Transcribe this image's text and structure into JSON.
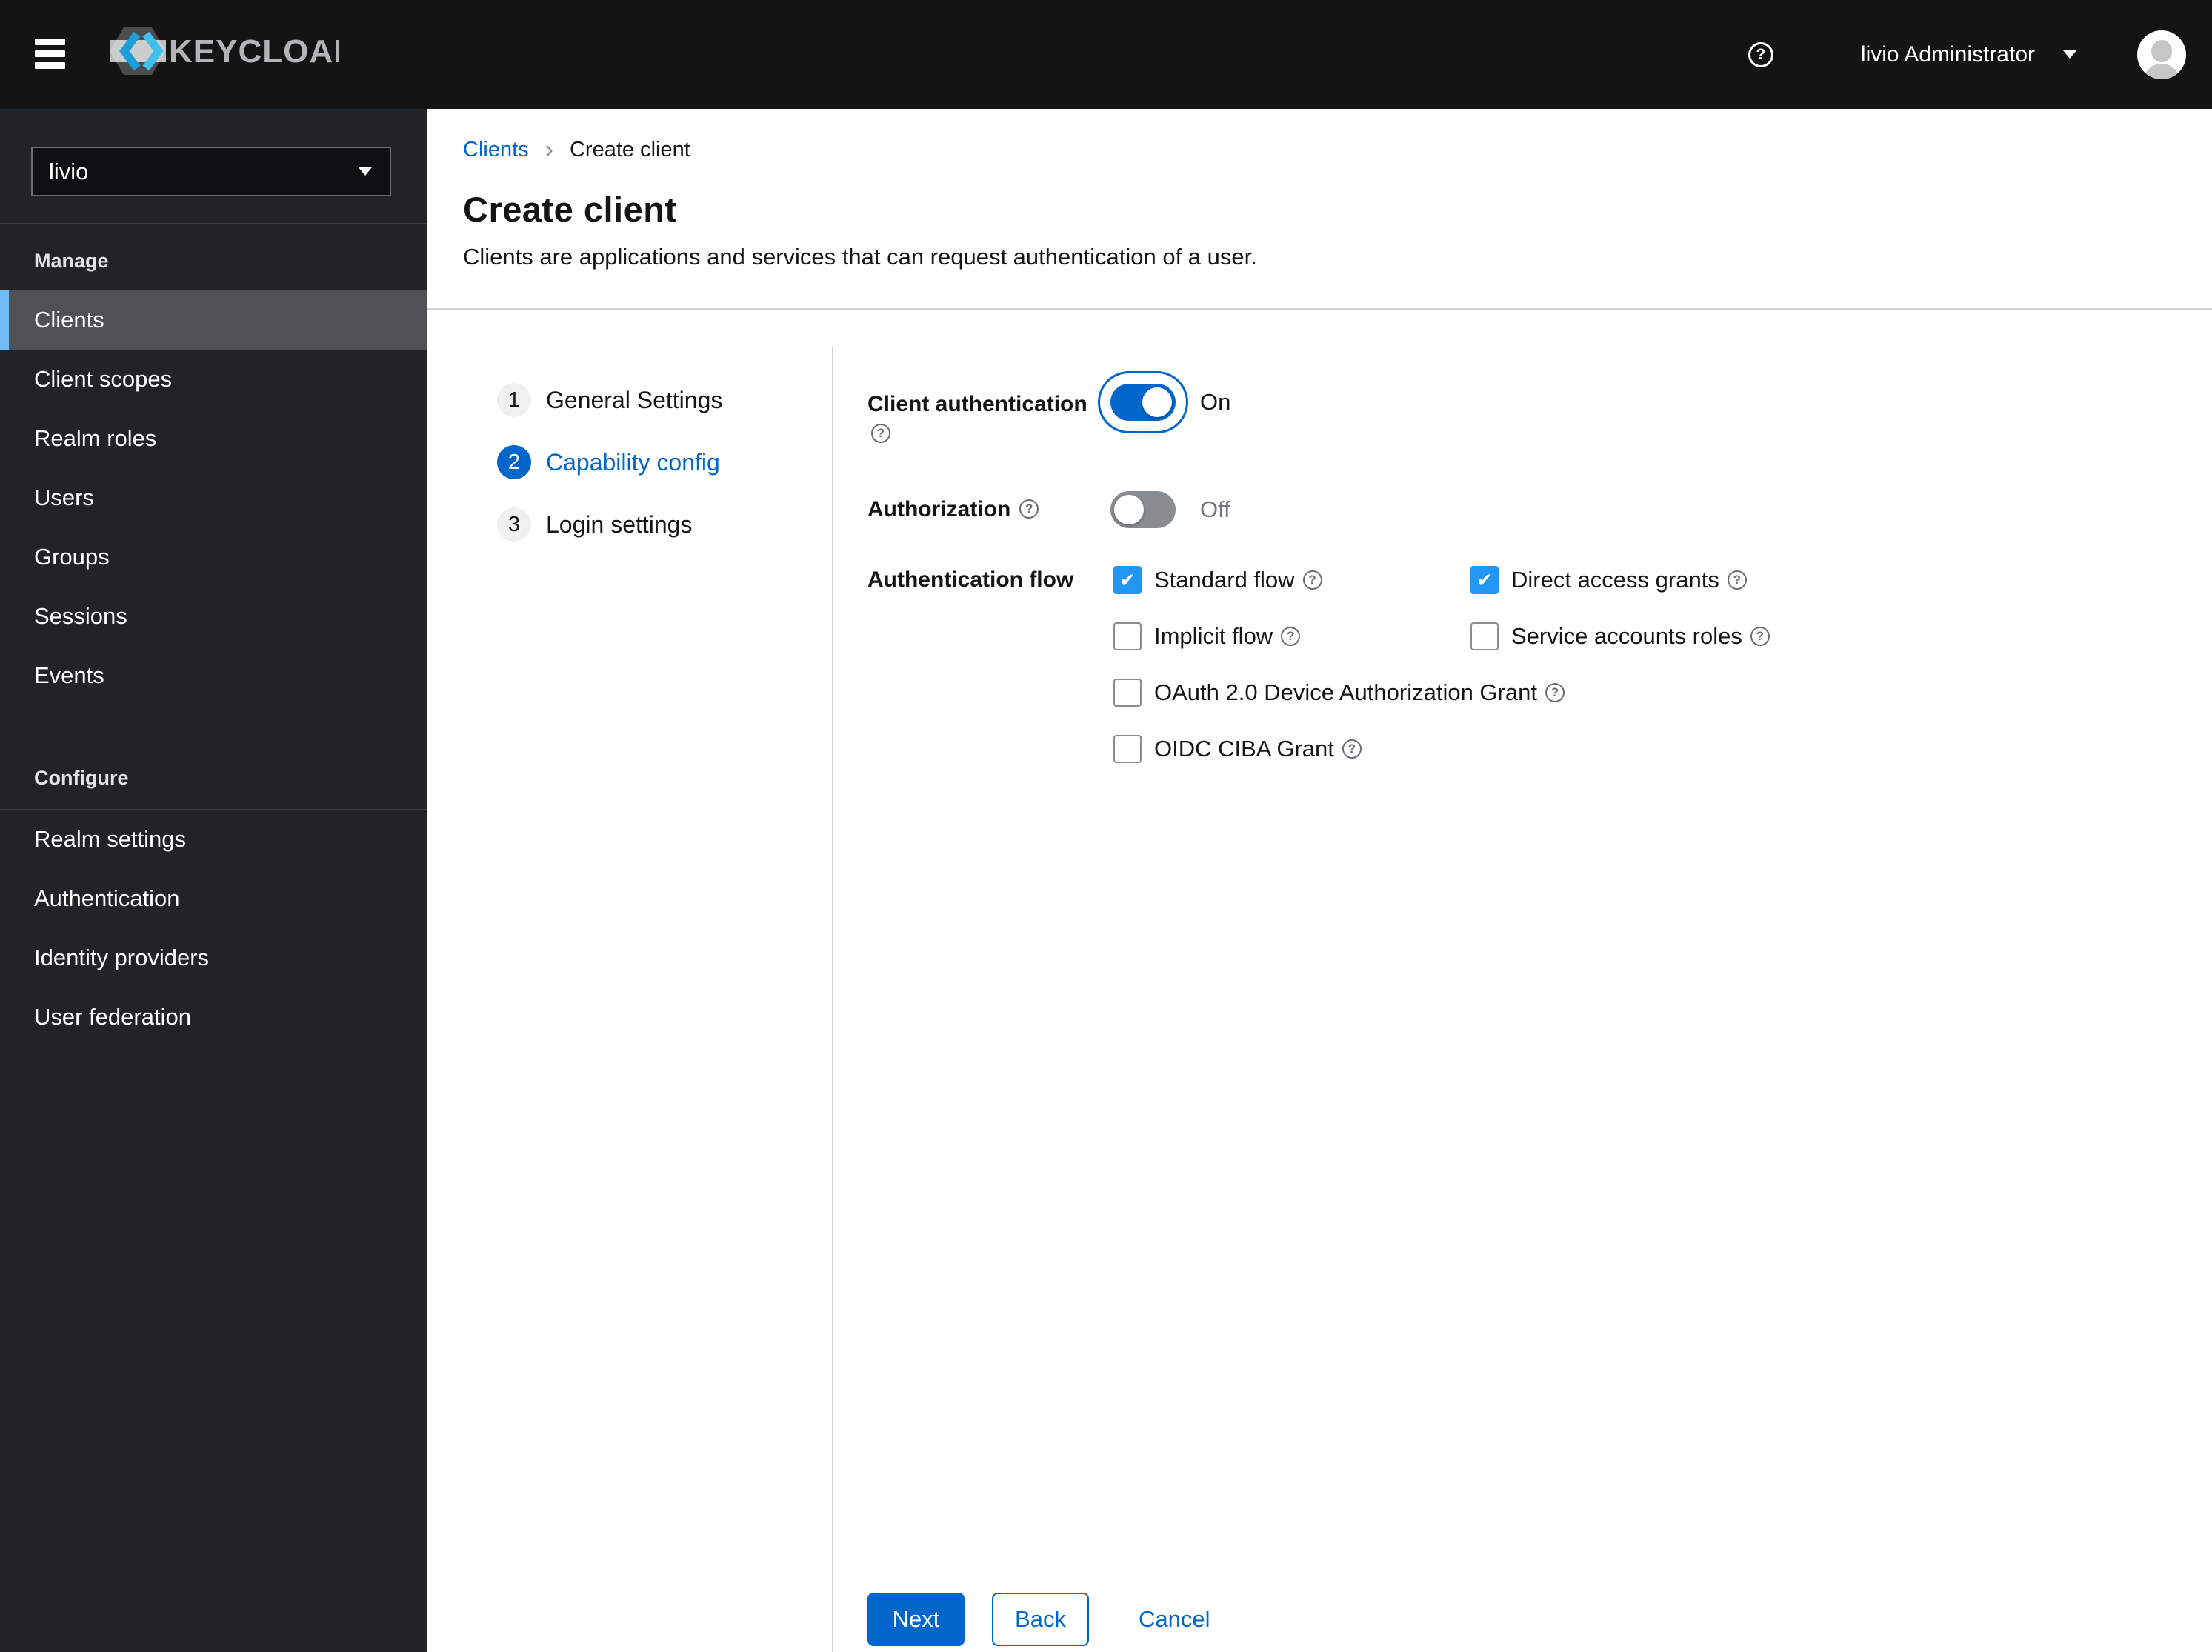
{
  "masthead": {
    "brand": "KEYCLOAK",
    "user": "livio Administrator"
  },
  "icons": {
    "help": "?",
    "check": "✔",
    "breadcrumb_separator": "›"
  },
  "sidebar": {
    "realm_selector": {
      "value": "livio"
    },
    "sections": [
      {
        "title": "Manage",
        "items": [
          {
            "label": "Clients",
            "selected": true
          },
          {
            "label": "Client scopes",
            "selected": false
          },
          {
            "label": "Realm roles",
            "selected": false
          },
          {
            "label": "Users",
            "selected": false
          },
          {
            "label": "Groups",
            "selected": false
          },
          {
            "label": "Sessions",
            "selected": false
          },
          {
            "label": "Events",
            "selected": false
          }
        ]
      },
      {
        "title": "Configure",
        "items": [
          {
            "label": "Realm settings",
            "selected": false
          },
          {
            "label": "Authentication",
            "selected": false
          },
          {
            "label": "Identity providers",
            "selected": false
          },
          {
            "label": "User federation",
            "selected": false
          }
        ]
      }
    ]
  },
  "breadcrumb": {
    "parent": "Clients",
    "current": "Create client"
  },
  "page": {
    "title": "Create client",
    "subtitle": "Clients are applications and services that can request authentication of a user."
  },
  "wizard": {
    "steps": [
      {
        "number": "1",
        "label": "General Settings",
        "active": false
      },
      {
        "number": "2",
        "label": "Capability config",
        "active": true
      },
      {
        "number": "3",
        "label": "Login settings",
        "active": false
      }
    ],
    "form": {
      "client_authentication": {
        "label": "Client authentication",
        "value": "On",
        "enabled": true
      },
      "authorization": {
        "label": "Authorization",
        "value": "Off",
        "enabled": false
      },
      "authentication_flow": {
        "label": "Authentication flow",
        "options": [
          {
            "label": "Standard flow",
            "checked": true
          },
          {
            "label": "Direct access grants",
            "checked": true
          },
          {
            "label": "Implicit flow",
            "checked": false
          },
          {
            "label": "Service accounts roles",
            "checked": false
          },
          {
            "label": "OAuth 2.0 Device Authorization Grant",
            "checked": false
          },
          {
            "label": "OIDC CIBA Grant",
            "checked": false
          }
        ]
      }
    },
    "footer": {
      "next": "Next",
      "back": "Back",
      "cancel": "Cancel"
    }
  },
  "colors": {
    "primary": "#0066cc",
    "checkbox_checked": "#2196f3",
    "nav_current_bar": "#73bcf7",
    "masthead_bg": "#141414",
    "sidebar_bg": "#212427"
  }
}
